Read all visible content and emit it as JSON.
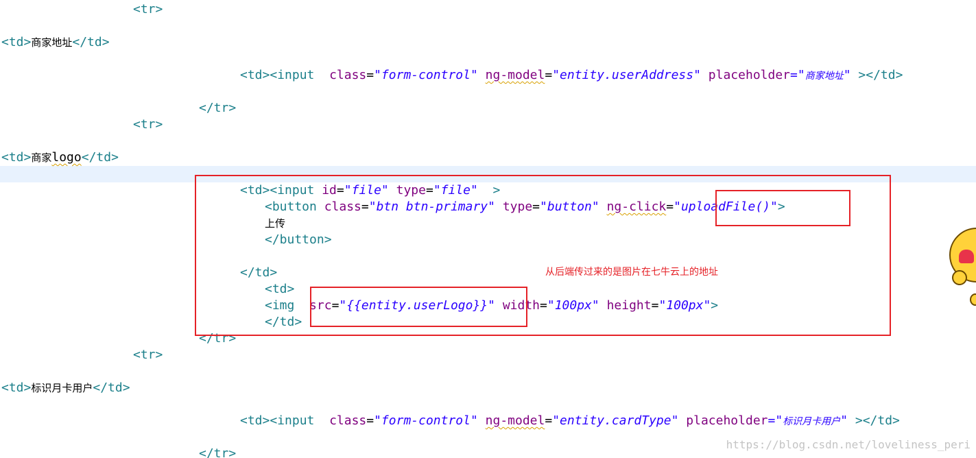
{
  "code_lines": {
    "l01": {
      "t1": "<tr>"
    },
    "l02": {
      "t1": "<td>",
      "cjk": "商家地址",
      "t2": "</td>"
    },
    "l03": {
      "t1": "<td><input",
      "a1": "class",
      "eq1": "=",
      "v1": "\"form-control\"",
      "a2": "ng-model",
      "eq2": "=",
      "v2": "\"entity.userAddress\"",
      "a3": "placeholder",
      "eq3": "=\"",
      "cjk": "商家地址",
      "q": "\"",
      "t2": "></td>"
    },
    "l04": {
      "t1": "</tr>"
    },
    "l05": {
      "t1": "<tr>"
    },
    "l06": {
      "t1": "<td>",
      "cjk": "商家",
      "txt": "logo",
      "t2": "</td>"
    },
    "l07": {
      "t1": "<td><input",
      "a1": "id",
      "eq1": "=",
      "v1": "\"file\"",
      "a2": "type",
      "eq2": "=",
      "v2": "\"file\"",
      "t2": ">"
    },
    "l08": {
      "t1": "<button",
      "a1": "class",
      "eq1": "=",
      "v1": "\"btn btn-primary\"",
      "a2": "type",
      "eq2": "=",
      "v2": "\"button\"",
      "a3": "ng-click",
      "eq3": "=",
      "v3": "\"uploadFile()\"",
      "t2": ">"
    },
    "l09": {
      "cjk": "上传"
    },
    "l10": {
      "t1": "</button>"
    },
    "l11": {
      "t1": "</td>"
    },
    "l12": {
      "t1": "<td>"
    },
    "l13": {
      "t1": "<img",
      "a1": "src",
      "eq1": "=",
      "v1": "\"{{entity.userLogo}}\"",
      "a2": "width",
      "eq2": "=",
      "v2": "\"100px\"",
      "a3": "height",
      "eq3": "=",
      "v3": "\"100px\"",
      "t2": ">"
    },
    "l14": {
      "t1": "</td>"
    },
    "l15": {
      "t1": "</tr>"
    },
    "l16": {
      "t1": "<tr>"
    },
    "l17": {
      "t1": "<td>",
      "cjk": "标识月卡用户",
      "t2": "</td>"
    },
    "l18": {
      "t1": "<td><input",
      "a1": "class",
      "eq1": "=",
      "v1": "\"form-control\"",
      "a2": "ng-model",
      "eq2": "=",
      "v2": "\"entity.cardType\"",
      "a3": "placeholder",
      "eq3": "=\"",
      "cjk": "标识月卡用户",
      "q": "\"",
      "t2": "></td>"
    },
    "l19": {
      "t1": "</tr>"
    }
  },
  "annotation": {
    "note": "从后端传过来的是图片在七牛云上的地址"
  },
  "watermark": "https://blog.csdn.net/loveliness_peri",
  "colors": {
    "tag": "#1b7f8a",
    "attribute": "#7f007f",
    "value": "#2a00ff",
    "highlight_line": "#e8f2fe",
    "annotation_red": "#e52127"
  },
  "icons": {
    "sticker": "heart-emoji-sticker"
  }
}
